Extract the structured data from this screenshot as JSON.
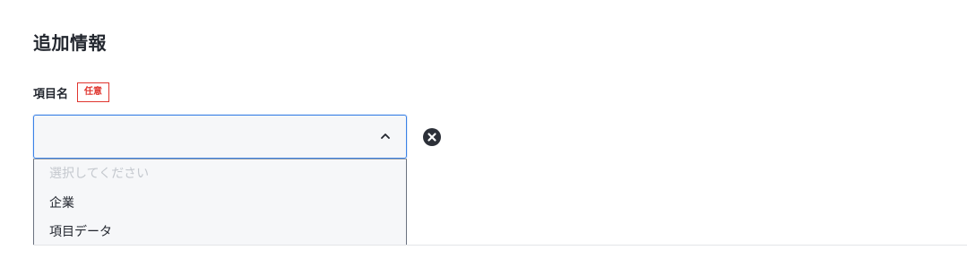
{
  "section": {
    "title": "追加情報"
  },
  "field": {
    "label": "項目名",
    "badge": "任意",
    "selected_value": ""
  },
  "dropdown": {
    "placeholder": "選択してください",
    "options": [
      "企業",
      "項目データ"
    ]
  },
  "icons": {
    "select_toggle": "chevron-up-icon",
    "clear": "clear-circle-icon"
  },
  "colors": {
    "focus_border": "#3b82e6",
    "badge_red": "#e0362f",
    "clear_button": "#2c3038",
    "placeholder_text": "#c4c8ce"
  }
}
